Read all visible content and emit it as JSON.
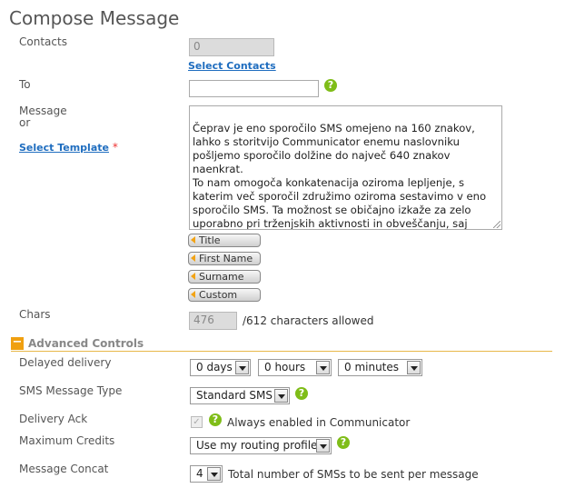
{
  "page": {
    "title": "Compose Message"
  },
  "contacts": {
    "label": "Contacts",
    "value": "0",
    "select_link": "Select Contacts"
  },
  "to": {
    "label": "To",
    "value": ""
  },
  "message": {
    "label_line1": "Message",
    "label_line2": "or",
    "select_template_link": "Select Template",
    "required_mark": "*",
    "body": "Čeprav je eno sporočilo SMS omejeno na 160 znakov,\nlahko s storitvijo Communicator enemu naslovniku\npošljemo sporočilo dolžine do največ 640 znakov naenkrat.\nTo nam omogoča konkatenacija oziroma lepljenje, s\nkaterim več sporočil združimo oziroma sestavimo v eno\nsporočilo SMS. Ta možnost se običajno izkaže za zelo\nuporabno pri trženjskih aktivnosti in obveščanju, saj lahko\ntako z enim sporočilom SMS prejemniku resnično\ndostavimo več informacij in bolj učinkovito sporočilo."
  },
  "tags": [
    "Title",
    "First Name",
    "Surname",
    "Custom"
  ],
  "chars": {
    "label": "Chars",
    "value": "476",
    "allowed": "/612 characters allowed"
  },
  "advanced": {
    "title": "Advanced Controls",
    "collapse_symbol": "−",
    "delayed_delivery": {
      "label": "Delayed delivery",
      "days": "0 days",
      "hours": "0 hours",
      "minutes": "0 minutes"
    },
    "sms_type": {
      "label": "SMS Message Type",
      "value": "Standard SMS"
    },
    "delivery_ack": {
      "label": "Delivery Ack",
      "text": "Always enabled in Communicator",
      "checked_symbol": "✓"
    },
    "max_credits": {
      "label": "Maximum Credits",
      "value": "Use my routing profile"
    },
    "concat": {
      "label": "Message Concat",
      "value": "4",
      "text": "Total number of SMSs to be sent per message"
    }
  },
  "help_symbol": "?",
  "colors": {
    "accent_orange": "#f0a010",
    "help_green": "#7fbd18",
    "link_blue": "#1f6dbf"
  }
}
